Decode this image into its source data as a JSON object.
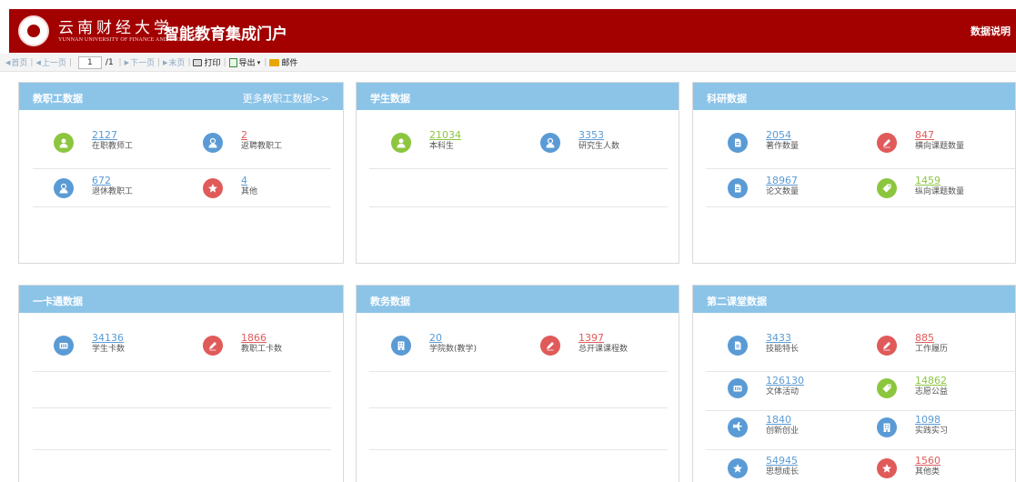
{
  "header": {
    "university_name": "云南财经大学",
    "university_english": "YUNNAN UNIVERSITY OF FINANCE AND ECONOMICS",
    "portal_title": "智能教育集成门户",
    "data_description": "数据说明"
  },
  "toolbar": {
    "first": "首页",
    "prev": "上一页",
    "page_value": "1",
    "page_total": "/1",
    "next": "下一页",
    "last": "末页",
    "print": "打印",
    "export": "导出",
    "mail": "邮件"
  },
  "cards": {
    "staff": {
      "title": "教职工数据",
      "more": "更多教职工数据>>",
      "stats": [
        {
          "value": "2127",
          "label": "在职教师工"
        },
        {
          "value": "2",
          "label": "返聘教职工"
        },
        {
          "value": "672",
          "label": "退休教职工"
        },
        {
          "value": "4",
          "label": "其他"
        }
      ]
    },
    "students": {
      "title": "学生数据",
      "stats": [
        {
          "value": "21034",
          "label": "本科生"
        },
        {
          "value": "3353",
          "label": "研究生人数"
        }
      ]
    },
    "research": {
      "title": "科研数据",
      "stats": [
        {
          "value": "2054",
          "label": "著作数量"
        },
        {
          "value": "847",
          "label": "横向课题数量"
        },
        {
          "value": "18967",
          "label": "论文数量"
        },
        {
          "value": "1459",
          "label": "纵向课题数量"
        }
      ]
    },
    "card": {
      "title": "一卡通数据",
      "stats": [
        {
          "value": "34136",
          "label": "学生卡数"
        },
        {
          "value": "1866",
          "label": "教职工卡数"
        }
      ]
    },
    "academic": {
      "title": "教务数据",
      "stats": [
        {
          "value": "20",
          "label": "学院数(教学)"
        },
        {
          "value": "1397",
          "label": "总开课课程数"
        }
      ]
    },
    "second": {
      "title": "第二课堂数据",
      "stats": [
        {
          "value": "3433",
          "label": "技能特长"
        },
        {
          "value": "885",
          "label": "工作履历"
        },
        {
          "value": "126130",
          "label": "文体活动"
        },
        {
          "value": "14862",
          "label": "志愿公益"
        },
        {
          "value": "1840",
          "label": "创新创业"
        },
        {
          "value": "1098",
          "label": "实践实习"
        },
        {
          "value": "54945",
          "label": "思想成长"
        },
        {
          "value": "1560",
          "label": "其他类"
        }
      ]
    }
  },
  "colors": {
    "header_bg": "#a30000",
    "card_head_bg": "#8cc4e8",
    "icon_green": "#8cc63f",
    "icon_blue": "#5a9bd5",
    "icon_red": "#e05a5a"
  },
  "icons": {
    "staff": [
      "person-icon",
      "person-badge-icon",
      "person-badge-icon",
      "star-icon"
    ],
    "students": [
      "person-icon",
      "person-badge-icon"
    ],
    "research": [
      "document-icon",
      "pencil-icon",
      "document-icon",
      "tag-icon"
    ],
    "card": [
      "id-card-icon",
      "pencil-icon"
    ],
    "academic": [
      "building-icon",
      "pencil-icon"
    ],
    "second": [
      "document-icon",
      "pencil-icon",
      "id-card-icon",
      "tag-icon",
      "plane-icon",
      "building-icon",
      "star-icon",
      "star-icon"
    ]
  }
}
